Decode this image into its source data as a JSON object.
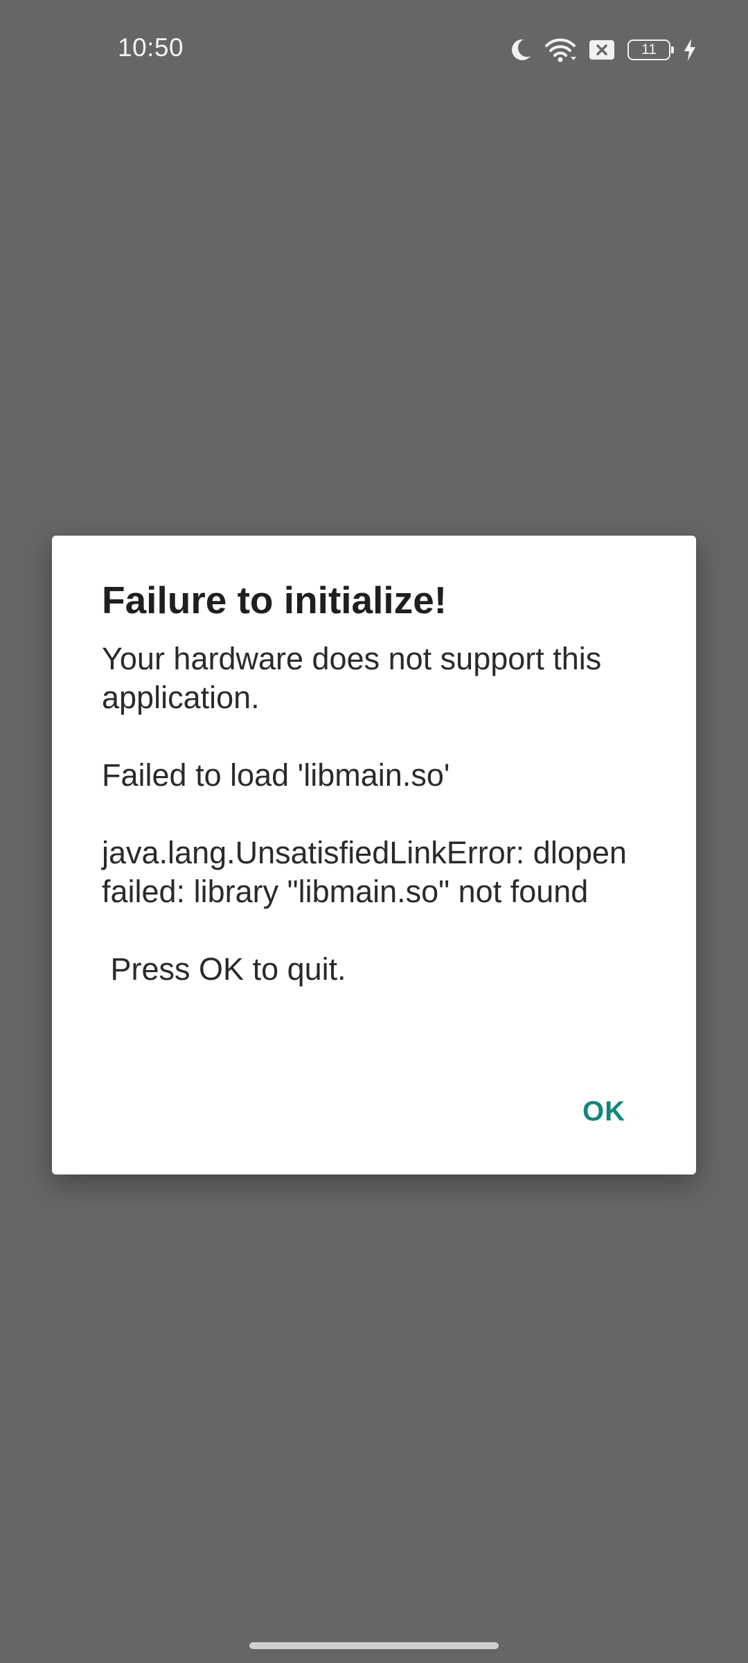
{
  "status_bar": {
    "time": "10:50",
    "battery_level": "11",
    "icons": [
      "moon-icon",
      "wifi-icon",
      "no-sim-icon",
      "battery-icon",
      "charging-bolt-icon"
    ]
  },
  "dialog": {
    "title": "Failure to initialize!",
    "message": "Your hardware does not support this application.\n\nFailed to load 'libmain.so'\n\njava.lang.UnsatisfiedLinkError: dlopen failed: library \"libmain.so\" not found\n\n Press OK to quit.",
    "ok_label": "OK"
  },
  "colors": {
    "scrim": "#666666",
    "accent": "#12867a",
    "dialog_bg": "#ffffff"
  }
}
